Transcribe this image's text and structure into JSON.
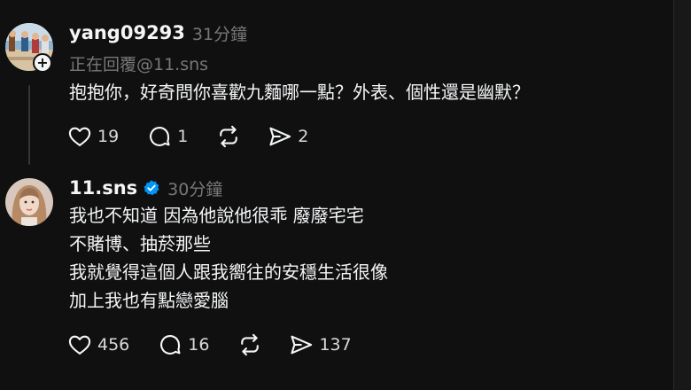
{
  "colors": {
    "background": "#101010",
    "text_primary": "#f3f5f7",
    "text_secondary": "#777777",
    "verified_blue": "#0095f6",
    "thread_line": "#333638"
  },
  "posts": [
    {
      "username": "yang09293",
      "time": "31分鐘",
      "replying_to": "正在回覆@11.sns",
      "avatar_icon": "avatar-photo",
      "has_follow_badge": true,
      "follow_badge": "+",
      "verified": false,
      "lines": [
        "抱抱你，好奇問你喜歡九麵哪一點？外表、個性還是幽默？"
      ],
      "actions": {
        "likes": "19",
        "replies": "1",
        "reposts": "",
        "shares": "2"
      }
    },
    {
      "username": "11.sns",
      "time": "30分鐘",
      "avatar_icon": "avatar-photo",
      "verified": true,
      "lines": [
        "我也不知道 因為他說他很乖 廢廢宅宅",
        "不賭博、抽菸那些",
        "我就覺得這個人跟我嚮往的安穩生活很像",
        "加上我也有點戀愛腦"
      ],
      "actions": {
        "likes": "456",
        "replies": "16",
        "reposts": "",
        "shares": "137"
      }
    }
  ],
  "icons": {
    "like": "heart-icon",
    "reply": "comment-icon",
    "repost": "repost-icon",
    "share": "share-icon",
    "verified": "verified-badge-icon",
    "follow": "plus-icon"
  }
}
